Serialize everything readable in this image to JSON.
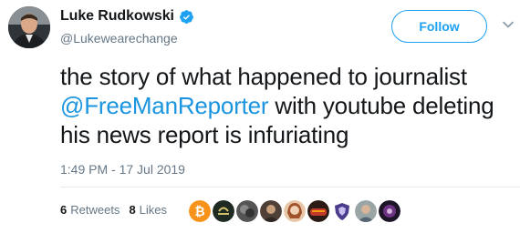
{
  "user": {
    "display_name": "Luke Rudkowski",
    "handle": "@Lukewearechange",
    "verified": true
  },
  "follow_button": {
    "label": "Follow"
  },
  "tweet": {
    "text_before": "the story of what happened to journalist ",
    "mention": "@FreeManReporter",
    "text_after": " with youtube deleting his news report is infuriating",
    "timestamp": "1:49 PM - 17 Jul 2019"
  },
  "stats": {
    "retweets_count": "6",
    "retweets_label": "Retweets",
    "likes_count": "8",
    "likes_label": "Likes"
  },
  "likers": [
    {
      "name": "bitcoin-avatar",
      "color": "#f7931a"
    },
    {
      "name": "libra-avatar",
      "color": "#2b3a2e"
    },
    {
      "name": "abstract-avatar",
      "color": "#4a4a4a"
    },
    {
      "name": "person-avatar",
      "color": "#6b5a48"
    },
    {
      "name": "woman-avatar",
      "color": "#c89b7b"
    },
    {
      "name": "sunset-avatar",
      "color": "#c0392b"
    },
    {
      "name": "shield-avatar",
      "color": "#4b3c8c"
    },
    {
      "name": "man-avatar",
      "color": "#7f8c8d"
    },
    {
      "name": "galaxy-avatar",
      "color": "#3b2a4a"
    }
  ],
  "colors": {
    "accent": "#1da1f2",
    "link": "#1b95e0",
    "muted": "#657786"
  }
}
